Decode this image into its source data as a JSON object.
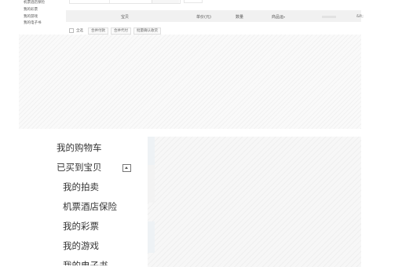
{
  "top_nav": {
    "items": [
      "机票酒店保险",
      "我的彩票",
      "我的游戏",
      "我的电子书"
    ]
  },
  "cart_header": {
    "item": "宝贝",
    "unit_price": "单价(元)",
    "quantity": "数量",
    "shipping": "商品运",
    "end": "&lt;"
  },
  "bulk_actions": {
    "select_all": "全选",
    "merge_pay": "合并付款",
    "merge_proxy": "合并代付",
    "batch_confirm": "批量确认收货"
  },
  "side_nav": {
    "cart": "我的购物车",
    "bought": "已买到宝贝",
    "auction": "我的拍卖",
    "travel": "机票酒店保险",
    "lottery": "我的彩票",
    "games": "我的游戏",
    "ebooks": "我的电子书"
  }
}
